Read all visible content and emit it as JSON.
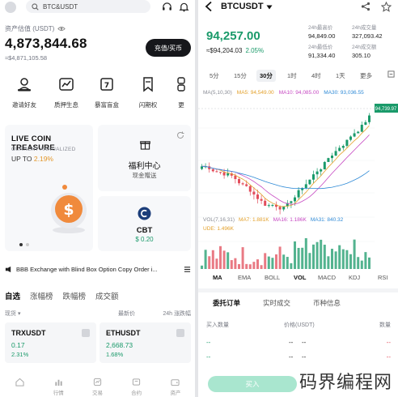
{
  "left": {
    "search": {
      "value": "BTC&USDT"
    },
    "assets": {
      "label": "资产估值 (USDT)",
      "value": "4,873,844.68",
      "sub_value": "≈$4,871,105.58",
      "deposit_label": "充值/买币"
    },
    "quick_actions": [
      {
        "label": "邀请好友",
        "icon": "person-icon"
      },
      {
        "label": "质押生息",
        "icon": "growth-chart-icon"
      },
      {
        "label": "暴富盲盒",
        "icon": "blind-box-icon"
      },
      {
        "label": "闪期权",
        "icon": "bookmark-icon"
      },
      {
        "label": "更",
        "icon": "more-icon"
      }
    ],
    "promo": {
      "title": "LIVE COIN TREASURE",
      "sub": "CURRENT ANNUALIZED",
      "up_prefix": "UP TO ",
      "up_pct": "2.19%"
    },
    "welfare": {
      "title": "福利中心",
      "sub": "现金赠送"
    },
    "cbt": {
      "name": "CBT",
      "price": "$ 0.20"
    },
    "notice": {
      "text": "BBB Exchange with Blind Box Option Copy Order i..."
    },
    "market_tabs": [
      "自选",
      "涨幅榜",
      "跌幅榜",
      "成交额"
    ],
    "market_header": {
      "col1": "现货",
      "col2": "最新价",
      "col3": "24h 涨跌幅"
    },
    "market_items": [
      {
        "symbol": "TRXUSDT",
        "price": "0.17",
        "change": "2.31%"
      },
      {
        "symbol": "ETHUSDT",
        "price": "2,668.73",
        "change": "1.68%"
      }
    ],
    "nav": [
      "",
      "行情",
      "交易",
      "合约",
      "资产"
    ]
  },
  "right": {
    "symbol": "BTCUSDT",
    "price": "94,257.00",
    "usd_price": "≈$94,204.03",
    "change": "2.05%",
    "stats": [
      {
        "label": "24h最高价",
        "value": "94,849.00"
      },
      {
        "label": "24h成交量",
        "value": "327,093.42"
      },
      {
        "label": "24h最低价",
        "value": "91,334.40"
      },
      {
        "label": "24h成交额",
        "value": "305.10"
      }
    ],
    "timeframes": [
      "5分",
      "15分",
      "30分",
      "1时",
      "4时",
      "1天",
      "更多"
    ],
    "active_timeframe": "30分",
    "ma_row": [
      {
        "label": "MA(5,10,30)",
        "color": "#8a8d96"
      },
      {
        "label": "MA5: 94,549.00",
        "color": "#e3a02a"
      },
      {
        "label": "MA10: 94,085.00",
        "color": "#c648c2"
      },
      {
        "label": "MA30: 93,036.55",
        "color": "#2f8ad6"
      }
    ],
    "vol_row": [
      {
        "label": "VOL(7,16,31)",
        "color": "#8a8d96"
      },
      {
        "label": "MA7: 1.881K",
        "color": "#e3a02a"
      },
      {
        "label": "MA16: 1.186K",
        "color": "#c648c2"
      },
      {
        "label": "MA31: 840.32",
        "color": "#2f8ad6"
      }
    ],
    "vol_extra": "UDE: 1.496K",
    "price_tag": "94,739.97",
    "indicator_tabs": [
      "MA",
      "EMA",
      "BOLL",
      "VOL",
      "MACD",
      "KDJ",
      "RSI"
    ],
    "orderbook_tabs": [
      "委托订单",
      "实时成交",
      "币种信息"
    ],
    "orderbook_header": {
      "buy": "买入数量",
      "price": "价格(USDT)",
      "sell": "数量"
    },
    "orderbook_rows": [
      {
        "buy": "--",
        "p1": "--",
        "p2": "--",
        "sell": "--"
      },
      {
        "buy": "--",
        "p1": "--",
        "p2": "--",
        "sell": "--"
      }
    ],
    "buy_label": "买入",
    "watermark": "码界编程网",
    "colors": {
      "up": "#1a9a6a",
      "down": "#e24d5b"
    }
  }
}
